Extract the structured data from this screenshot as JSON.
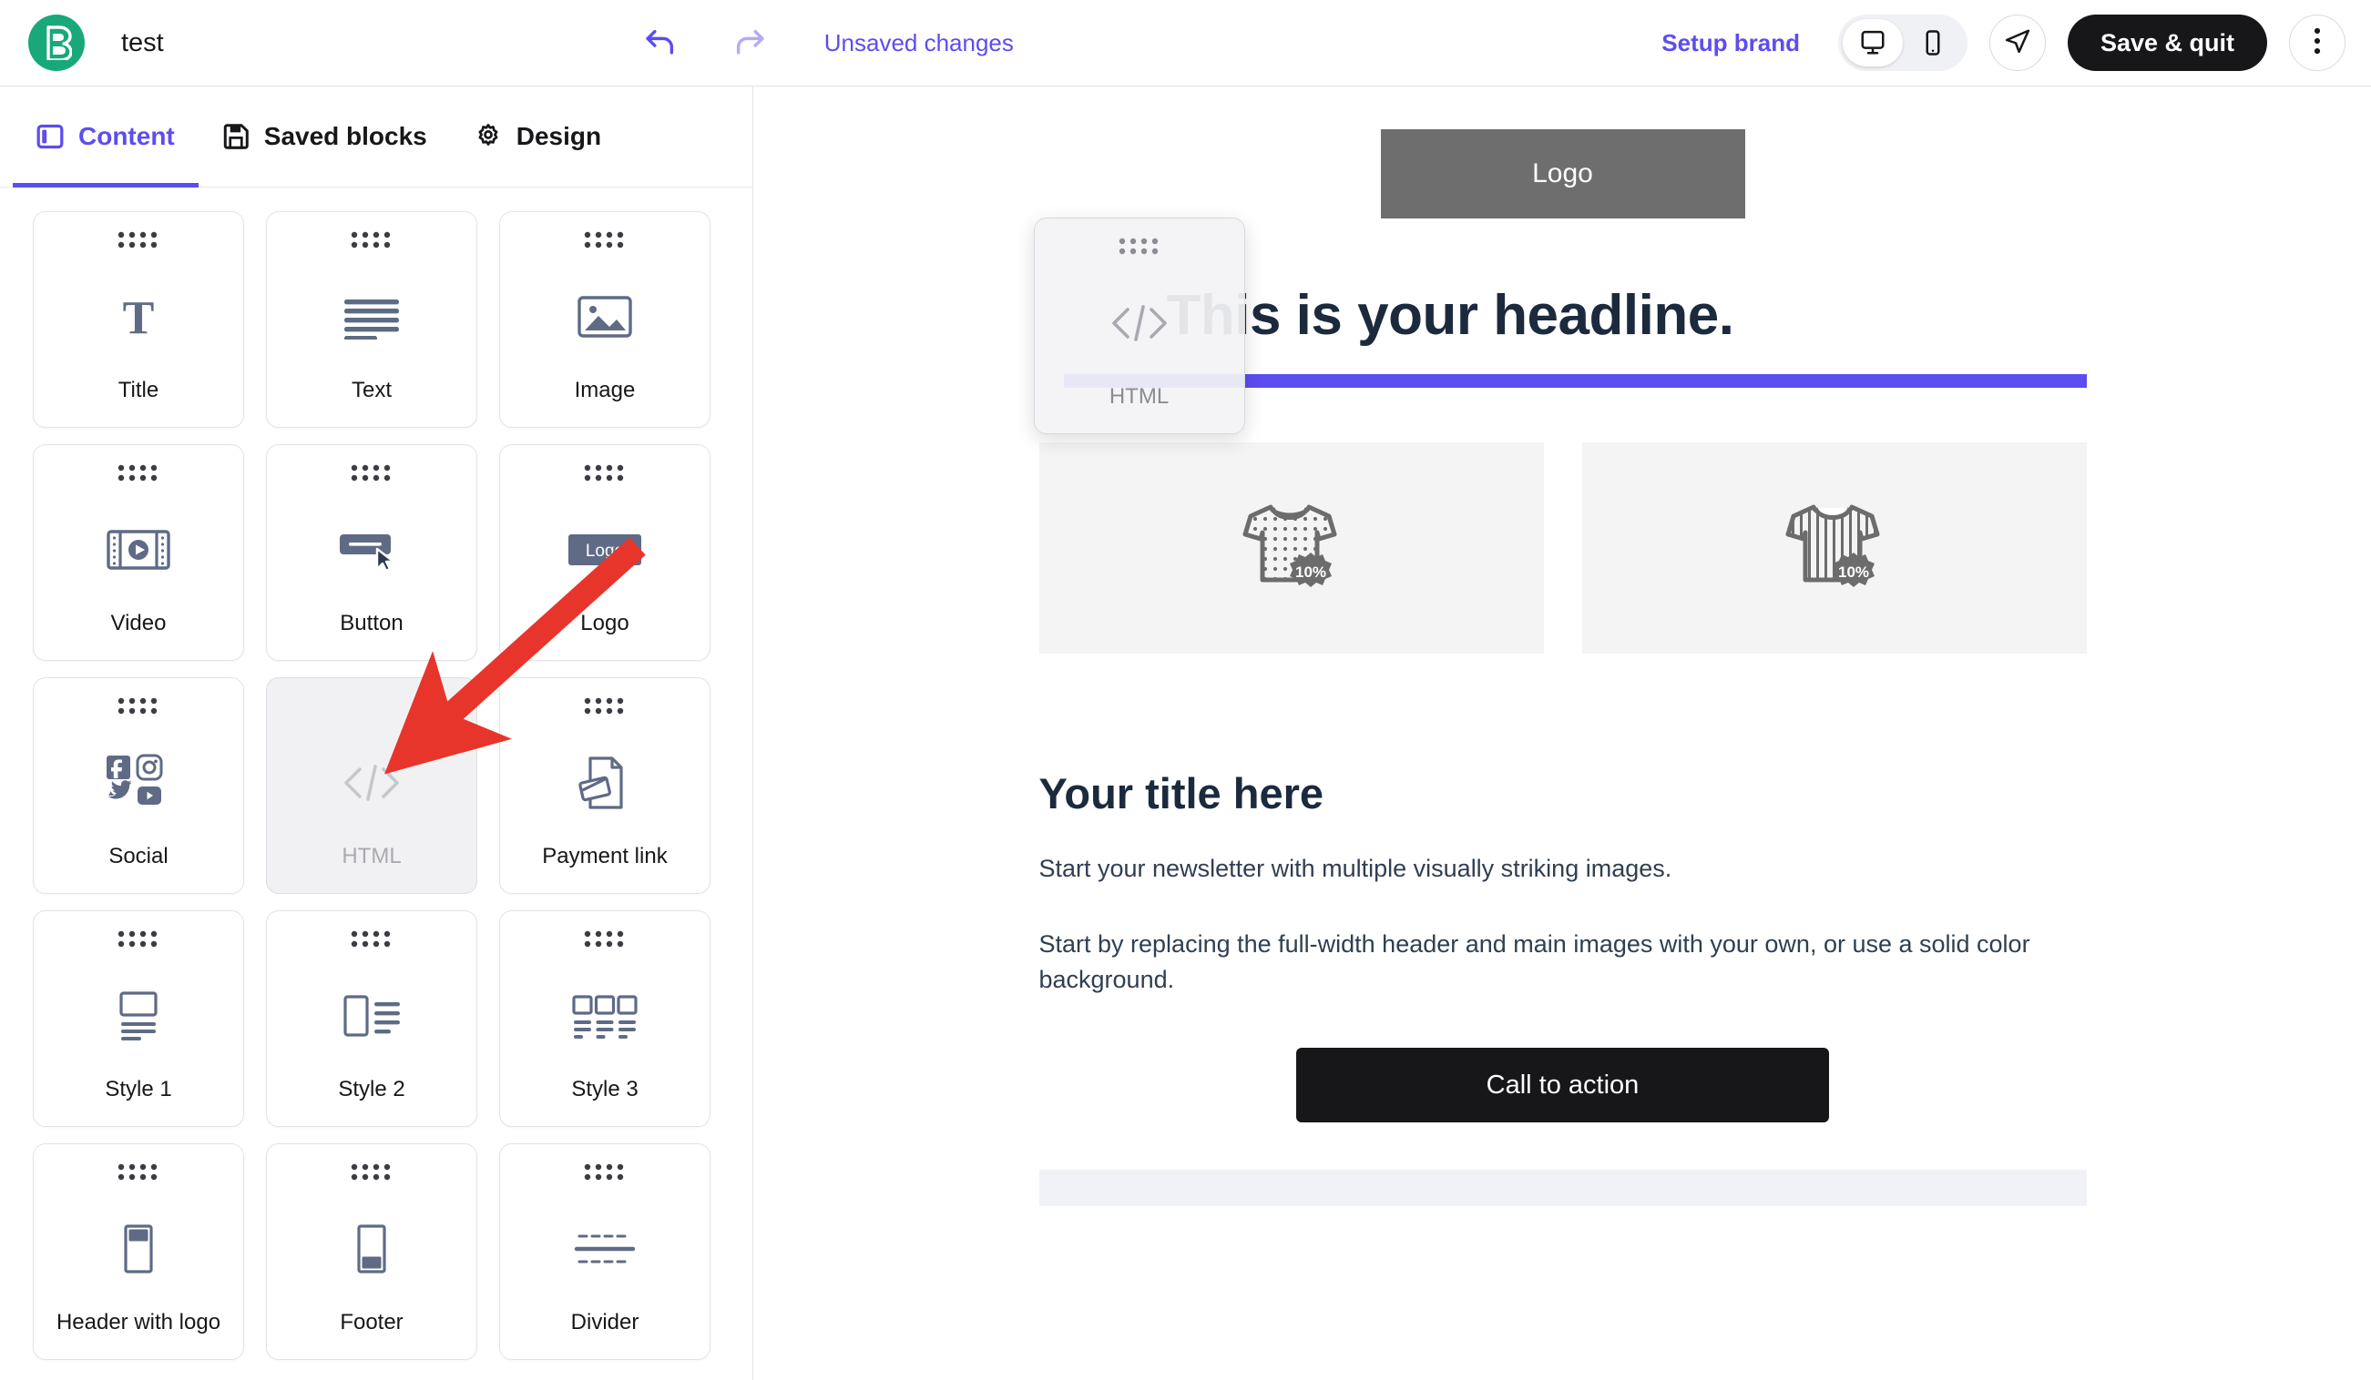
{
  "topbar": {
    "logo_icon": "brevo-b-logo",
    "doc_title": "test",
    "undo_icon": "undo-arrow-icon",
    "redo_icon": "redo-arrow-icon",
    "unsaved_status": "Unsaved changes",
    "setup_brand_label": "Setup brand",
    "desktop_icon": "desktop-monitor-icon",
    "mobile_icon": "mobile-phone-icon",
    "send_icon": "send-paper-plane-icon",
    "save_quit_label": "Save & quit",
    "more_icon": "three-dots-vertical-icon",
    "accent_color": "#5c4df0",
    "brand_green": "#18a87a",
    "dark_button_color": "#17171a"
  },
  "left_panel": {
    "tabs": [
      {
        "label": "Content",
        "icon": "panel-layout-icon",
        "active": true
      },
      {
        "label": "Saved blocks",
        "icon": "floppy-disk-save-icon",
        "active": false
      },
      {
        "label": "Design",
        "icon": "gear-icon",
        "active": false
      }
    ],
    "blocks": [
      {
        "label": "Title",
        "icon": "serif-t-icon",
        "state": "normal"
      },
      {
        "label": "Text",
        "icon": "text-lines-icon",
        "state": "normal"
      },
      {
        "label": "Image",
        "icon": "picture-mountain-icon",
        "state": "normal"
      },
      {
        "label": "Video",
        "icon": "film-play-icon",
        "state": "normal"
      },
      {
        "label": "Button",
        "icon": "button-cursor-icon",
        "state": "normal"
      },
      {
        "label": "Logo",
        "icon": "logo-badge-icon",
        "state": "normal"
      },
      {
        "label": "Social",
        "icon": "social-networks-icon",
        "state": "normal"
      },
      {
        "label": "HTML",
        "icon": "code-brackets-icon",
        "state": "dragging"
      },
      {
        "label": "Payment link",
        "icon": "document-credit-card-icon",
        "state": "normal"
      },
      {
        "label": "Style 1",
        "icon": "style-image-top-icon",
        "state": "normal"
      },
      {
        "label": "Style 2",
        "icon": "style-image-left-icon",
        "state": "normal"
      },
      {
        "label": "Style 3",
        "icon": "style-three-columns-icon",
        "state": "normal"
      },
      {
        "label": "Header with logo",
        "icon": "header-with-logo-icon",
        "state": "normal"
      },
      {
        "label": "Footer",
        "icon": "footer-icon",
        "state": "normal"
      },
      {
        "label": "Divider",
        "icon": "divider-lines-icon",
        "state": "normal"
      }
    ],
    "logo_block_badge_text": "Logo"
  },
  "drag_ghost": {
    "label": "HTML",
    "icon": "code-brackets-icon"
  },
  "canvas": {
    "logo_placeholder_text": "Logo",
    "headline": "This is your headline.",
    "products": [
      {
        "icon": "tshirt-polka-dot-icon",
        "badge": "10%"
      },
      {
        "icon": "tshirt-striped-icon",
        "badge": "10%"
      }
    ],
    "section_title": "Your title here",
    "paragraph_1": "Start your newsletter with multiple visually striking images.",
    "paragraph_2": "Start by replacing the full-width header and main images with your own, or use a solid color background.",
    "cta_label": "Call to action"
  },
  "annotation": {
    "arrow_icon": "red-arrow-annotation",
    "arrow_color": "#e8352b"
  }
}
